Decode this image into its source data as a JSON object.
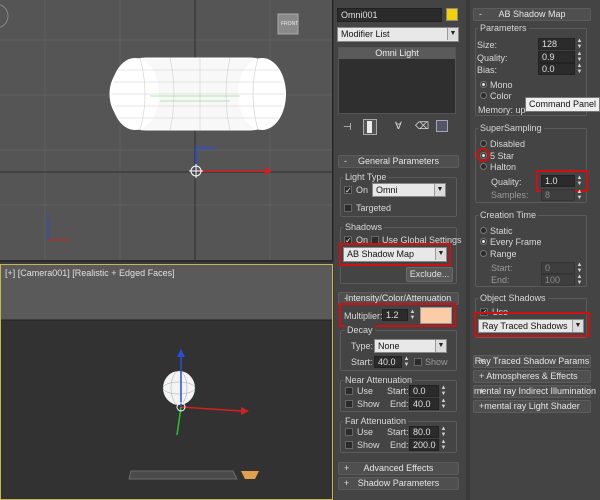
{
  "viewport_top": {
    "view_cube_label": "FRONT"
  },
  "viewport_camera": {
    "label": "[+] [Camera001] [Realistic + Edged Faces]"
  },
  "modify_panel": {
    "object_name": "Omni001",
    "object_color": "#f2d200",
    "modifier_list": "Modifier List",
    "stack_item": "Omni Light",
    "general_parameters": {
      "title": "General Parameters",
      "light_type_group": "Light Type",
      "on_label": "On",
      "light_type": "Omni",
      "targeted_label": "Targeted",
      "shadows_group": "Shadows",
      "shadows_on_label": "On",
      "use_global_label": "Use Global Settings",
      "shadow_type": "AB Shadow Map",
      "exclude_label": "Exclude..."
    },
    "intensity": {
      "title": "Intensity/Color/Attenuation",
      "multiplier_label": "Multiplier:",
      "multiplier": "1.2",
      "color": "#fccca6",
      "decay_group": "Decay",
      "type_label": "Type:",
      "decay_type": "None",
      "start_label": "Start:",
      "start_value": "40.0",
      "show_label": "Show",
      "near_group": "Near Attenuation",
      "near_use": "Use",
      "near_show": "Show",
      "near_start_label": "Start:",
      "near_start": "0.0",
      "near_end_label": "End:",
      "near_end": "40.0",
      "far_group": "Far Attenuation",
      "far_use": "Use",
      "far_show": "Show",
      "far_start_label": "Start:",
      "far_start": "80.0",
      "far_end_label": "End:",
      "far_end": "200.0"
    },
    "advanced_effects": "Advanced Effects",
    "shadow_parameters": "Shadow Parameters"
  },
  "ab_shadow": {
    "title": "AB Shadow Map",
    "parameters_group": "Parameters",
    "size_label": "Size:",
    "size": "128",
    "quality_label": "Quality:",
    "quality": "0.9",
    "bias_label": "Bias:",
    "bias": "0.0",
    "mono_label": "Mono",
    "color_label": "Color",
    "memory_label": "Memory: up",
    "tooltip": "Command Panel",
    "supersampling_group": "SuperSampling",
    "disabled_label": "Disabled",
    "five_star_label": "5 Star",
    "halton_label": "Halton",
    "ss_quality_label": "Quality:",
    "ss_quality": "1.0",
    "samples_label": "Samples:",
    "samples": "8",
    "creation_group": "Creation Time",
    "static_label": "Static",
    "every_frame_label": "Every Frame",
    "range_label": "Range",
    "range_start_label": "Start:",
    "range_start": "0",
    "range_end_label": "End:",
    "range_end": "100",
    "object_shadows_group": "Object Shadows",
    "use_label": "Use",
    "object_shadow_type": "Ray Traced Shadows",
    "collapsed": [
      "Ray Traced Shadow Params",
      "Atmospheres & Effects",
      "mental ray Indirect Illumination",
      "mental ray Light Shader"
    ]
  },
  "colors": {
    "highlight": "#d01010",
    "accent_viewport": "#c8b450"
  }
}
